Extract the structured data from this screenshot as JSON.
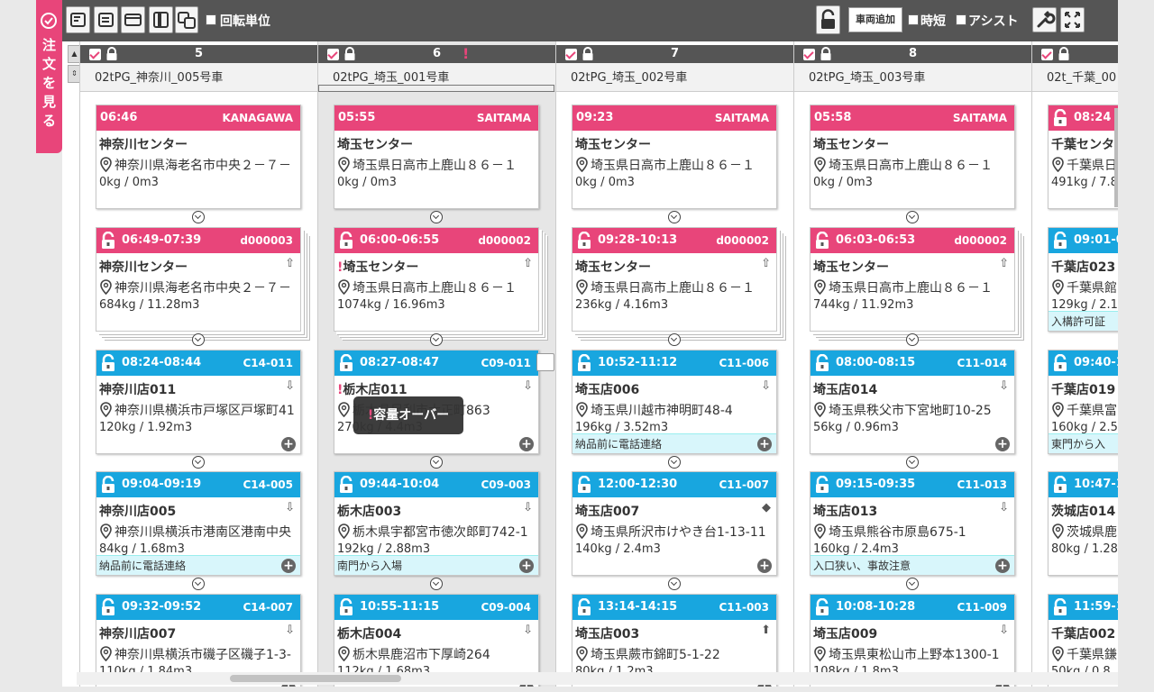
{
  "sidebar_tab": {
    "label": "注\n文\nを\n見\nる"
  },
  "toolbar": {
    "rotation_unit_label": "回転単位",
    "add_vehicle_label": "車両追加",
    "shorten_label": "時短",
    "assist_label": "アシスト"
  },
  "tooltip": {
    "bang": "!",
    "text": "容量オーバー"
  },
  "columns": [
    {
      "number": "5",
      "name": "02tPG_神奈川_005号車",
      "warn": "",
      "cards": [
        {
          "time": "06:46",
          "tag": "KANAGAWA",
          "color": "pink",
          "locked": false,
          "title": "神奈川センター",
          "address": "神奈川県海老名市中央２－７－",
          "load": "0kg / 0m3"
        },
        {
          "time": "06:49-07:39",
          "tag": "d000003",
          "color": "pink",
          "locked": true,
          "title": "神奈川センター",
          "address": "神奈川県海老名市中央２－７－",
          "load": "684kg / 11.28m3",
          "side": "⇧"
        },
        {
          "time": "08:24-08:44",
          "tag": "C14-011",
          "color": "blue",
          "locked": true,
          "title": "神奈川店011",
          "address": "神奈川県横浜市戸塚区戸塚町41",
          "load": "120kg / 1.92m3",
          "side": "⇩"
        },
        {
          "time": "09:04-09:19",
          "tag": "C14-005",
          "color": "blue",
          "locked": true,
          "title": "神奈川店005",
          "address": "神奈川県横浜市港南区港南中央",
          "load": "84kg / 1.68m3",
          "side": "⇩",
          "note": "納品前に電話連絡"
        },
        {
          "time": "09:32-09:52",
          "tag": "C14-007",
          "color": "blue",
          "locked": true,
          "title": "神奈川店007",
          "address": "神奈川県横浜市磯子区磯子1-3-",
          "load": "110kg / 1.84m3",
          "side": "⇩"
        }
      ]
    },
    {
      "number": "6",
      "name": "02tPG_埼玉_001号車",
      "warn": "!",
      "cards": [
        {
          "time": "05:55",
          "tag": "SAITAMA",
          "color": "pink",
          "locked": false,
          "title": "埼玉センター",
          "address": "埼玉県日高市上鹿山８６－１",
          "load": "0kg / 0m3"
        },
        {
          "time": "06:00-06:55",
          "tag": "d000002",
          "color": "pink",
          "locked": true,
          "title": "埼玉センター",
          "bang": "!",
          "address": "埼玉県日高市上鹿山８６－１",
          "load": "1074kg / 16.96m3",
          "side": "⇧"
        },
        {
          "time": "08:27-08:47",
          "tag": "C09-011",
          "color": "blue",
          "locked": true,
          "title": "栃木店011",
          "bang": "!",
          "address": "栃木県足利市大正町863",
          "load": "270kg / 4.4m3",
          "side": "⇩"
        },
        {
          "time": "09:44-10:04",
          "tag": "C09-003",
          "color": "blue",
          "locked": true,
          "title": "栃木店003",
          "address": "栃木県宇都宮市徳次郎町742-1",
          "load": "192kg / 2.88m3",
          "side": "⇩",
          "note": "南門から入場"
        },
        {
          "time": "10:55-11:15",
          "tag": "C09-004",
          "color": "blue",
          "locked": true,
          "title": "栃木店004",
          "address": "栃木県鹿沼市下厚崎264",
          "load": "112kg / 1.68m3",
          "side": "⇩"
        }
      ]
    },
    {
      "number": "7",
      "name": "02tPG_埼玉_002号車",
      "warn": "",
      "cards": [
        {
          "time": "09:23",
          "tag": "SAITAMA",
          "color": "pink",
          "locked": false,
          "title": "埼玉センター",
          "address": "埼玉県日高市上鹿山８６－１",
          "load": "0kg / 0m3"
        },
        {
          "time": "09:28-10:13",
          "tag": "d000002",
          "color": "pink",
          "locked": true,
          "title": "埼玉センター",
          "address": "埼玉県日高市上鹿山８６－１",
          "load": "236kg / 4.16m3",
          "side": "⇧"
        },
        {
          "time": "10:52-11:12",
          "tag": "C11-006",
          "color": "blue",
          "locked": true,
          "title": "埼玉店006",
          "address": "埼玉県川越市神明町48-4",
          "load": "196kg / 3.52m3",
          "side": "⇩",
          "note": "納品前に電話連絡"
        },
        {
          "time": "12:00-12:30",
          "tag": "C11-007",
          "color": "blue",
          "locked": true,
          "title": "埼玉店007",
          "address": "埼玉県所沢市けやき台1-13-11",
          "load": "140kg / 2.4m3",
          "side": "◆"
        },
        {
          "time": "13:14-14:15",
          "tag": "C11-003",
          "color": "blue",
          "locked": true,
          "title": "埼玉店003",
          "address": "埼玉県蕨市錦町5-1-22",
          "load": "80kg / 1.2m3",
          "side": "⬆"
        }
      ]
    },
    {
      "number": "8",
      "name": "02tPG_埼玉_003号車",
      "warn": "",
      "cards": [
        {
          "time": "05:58",
          "tag": "SAITAMA",
          "color": "pink",
          "locked": false,
          "title": "埼玉センター",
          "address": "埼玉県日高市上鹿山８６－１",
          "load": "0kg / 0m3"
        },
        {
          "time": "06:03-06:53",
          "tag": "d000002",
          "color": "pink",
          "locked": true,
          "title": "埼玉センター",
          "address": "埼玉県日高市上鹿山８６－１",
          "load": "744kg / 11.92m3",
          "side": "⇧"
        },
        {
          "time": "08:00-08:15",
          "tag": "C11-014",
          "color": "blue",
          "locked": true,
          "title": "埼玉店014",
          "address": "埼玉県秩父市下宮地町10-25",
          "load": "56kg / 0.96m3",
          "side": "⇩"
        },
        {
          "time": "09:15-09:35",
          "tag": "C11-013",
          "color": "blue",
          "locked": true,
          "title": "埼玉店013",
          "address": "埼玉県熊谷市原島675-1",
          "load": "160kg / 2.4m3",
          "side": "⇩",
          "note": "入口狭い、事故注意"
        },
        {
          "time": "10:08-10:28",
          "tag": "C11-009",
          "color": "blue",
          "locked": true,
          "title": "埼玉店009",
          "address": "埼玉県東松山市上野本1300-1",
          "load": "108kg / 1.8m3",
          "side": "⇩"
        }
      ]
    },
    {
      "number": "",
      "name": "02t_千葉_00",
      "warn": "",
      "cards": [
        {
          "time": "08:24",
          "tag": "",
          "color": "pink",
          "locked": true,
          "title": "千葉センタ",
          "address": "千葉県日",
          "load": "491kg / 7.8"
        },
        {
          "time": "09:01-0",
          "tag": "",
          "color": "blue",
          "locked": true,
          "title": "千葉店023",
          "address": "千葉県館",
          "load": "129kg / 2.1",
          "note": "入構許可証"
        },
        {
          "time": "09:40-1",
          "tag": "",
          "color": "blue",
          "locked": true,
          "title": "千葉店019",
          "address": "千葉県富",
          "load": "160kg / 2.5",
          "note": "東門から入"
        },
        {
          "time": "10:47-1",
          "tag": "",
          "color": "blue",
          "locked": true,
          "title": "茨城店014",
          "address": "茨城県鹿",
          "load": "80kg / 1.28"
        },
        {
          "time": "11:59-1",
          "tag": "",
          "color": "blue",
          "locked": true,
          "title": "千葉店002",
          "address": "千葉県鎌",
          "load": "50kg / 0.8"
        }
      ]
    }
  ]
}
